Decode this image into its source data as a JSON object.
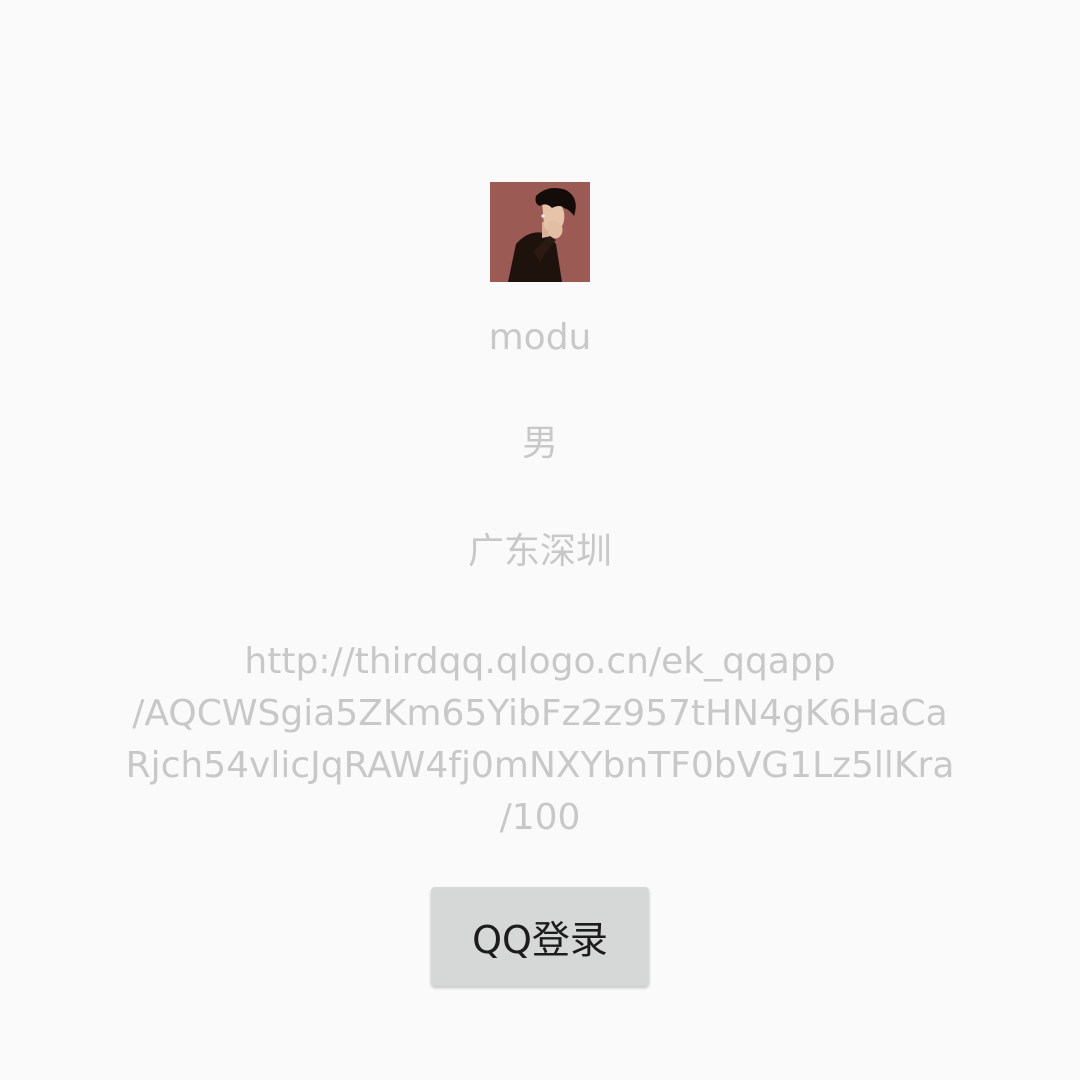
{
  "profile": {
    "avatar_icon": "user-avatar",
    "nickname": "modu",
    "gender": "男",
    "location": "广东深圳",
    "avatar_url_lines": [
      "http://thirdqq.qlogo.cn/ek_qqapp",
      "/AQCWSgia5ZKm65YibFz2z957tHN4gK6HaCa",
      "Rjch54vlicJqRAW4fj0mNXYbnTF0bVG1Lz5llKra",
      "/100"
    ]
  },
  "actions": {
    "qq_login_label": "QQ登录"
  },
  "colors": {
    "background": "#fafafa",
    "text_muted": "#c8c8c8",
    "button_bg": "#d6d7d7",
    "avatar_bg": "#9c5a55"
  }
}
